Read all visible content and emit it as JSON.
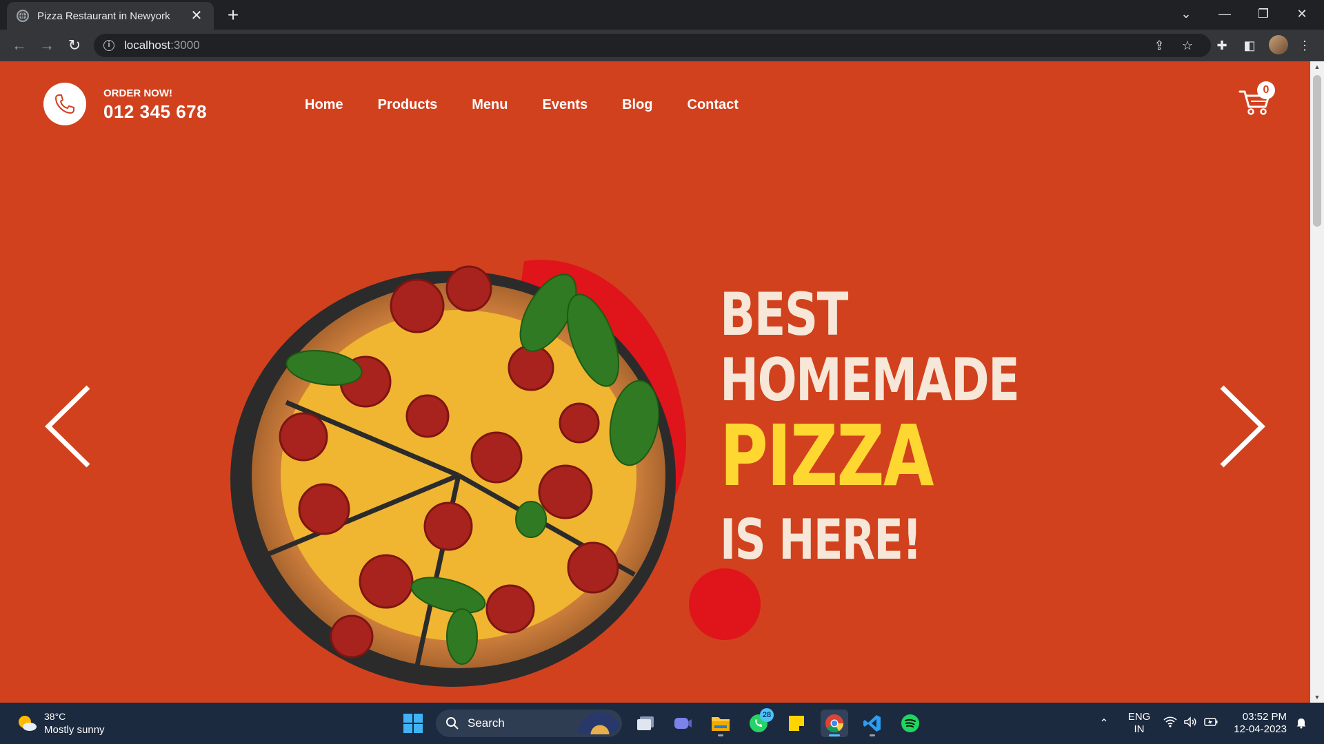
{
  "browser": {
    "tab_title": "Pizza Restaurant in Newyork",
    "new_tab_symbol": "+",
    "url_host": "localhost",
    "url_port": ":3000"
  },
  "header": {
    "order_label": "ORDER NOW!",
    "phone": "012 345 678",
    "nav": [
      "Home",
      "Products",
      "Menu",
      "Events",
      "Blog",
      "Contact"
    ],
    "cart_count": "0"
  },
  "hero": {
    "line1": "BEST",
    "line2": "HOMEMADE",
    "line3": "PIZZA",
    "line4": "IS HERE!"
  },
  "colors": {
    "page_background": "#d1411e",
    "blob": "#e0141b",
    "accent_yellow": "#ffd731",
    "headline_cream": "#f6e7d8"
  },
  "taskbar": {
    "weather_temp": "38°C",
    "weather_desc": "Mostly sunny",
    "search_label": "Search",
    "whatsapp_badge": "28",
    "lang_line1": "ENG",
    "lang_line2": "IN",
    "time": "03:52 PM",
    "date": "12-04-2023"
  },
  "icons": [
    "phone-icon",
    "cart-icon",
    "arrow-left-icon",
    "arrow-right-icon",
    "windows-start-icon",
    "search-icon",
    "chrome-icon",
    "vscode-icon",
    "spotify-icon",
    "whatsapp-icon",
    "file-explorer-icon",
    "sticky-notes-icon",
    "teams-icon",
    "task-view-icon",
    "wifi-icon",
    "volume-icon",
    "battery-icon"
  ]
}
